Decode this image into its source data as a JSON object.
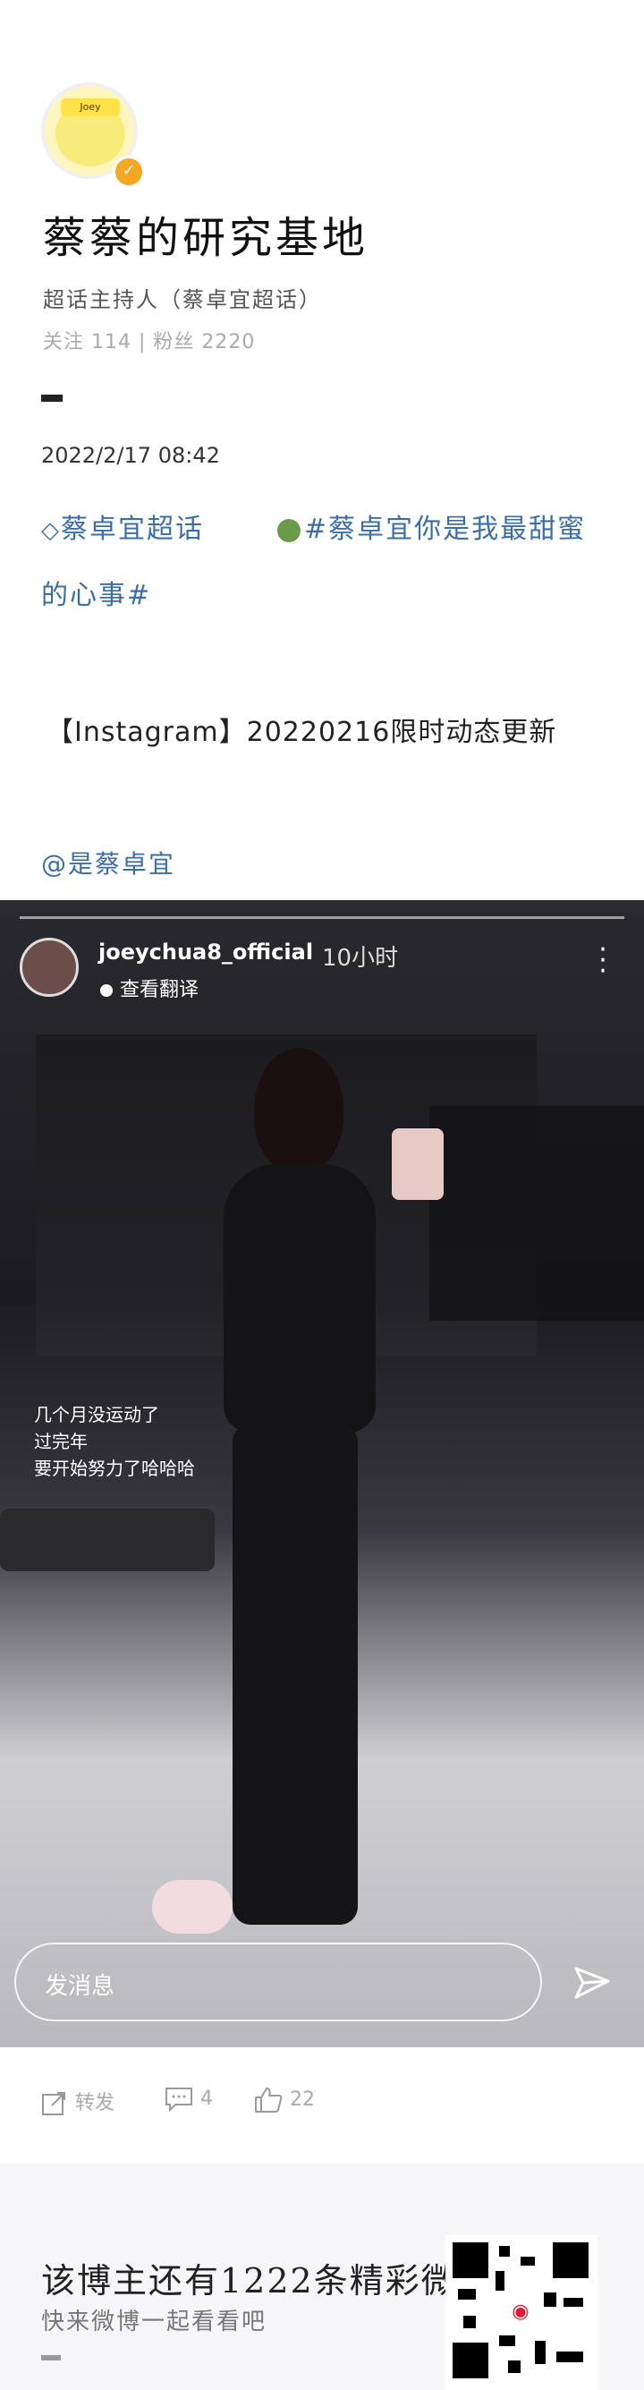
{
  "profile": {
    "name": "蔡蔡的研究基地",
    "role": "超话主持人（蔡卓宜超话）",
    "stats": "关注 114 | 粉丝 2220",
    "avatar_tag": "Joey"
  },
  "post": {
    "date": "2022/2/17 08:42",
    "super_topic": "蔡卓宜超话",
    "hashtag": "#蔡卓宜你是我最甜蜜",
    "hashtag_cont": "的心事#",
    "text": "【Instagram】20220216限时动态更新",
    "mention": "@是蔡卓宜"
  },
  "story": {
    "username": "joeychua8_official",
    "time": "10小时",
    "translate": "查看翻译",
    "caption": [
      "几个月没运动了",
      "过完年",
      "要开始努力了哈哈哈"
    ],
    "message_placeholder": "发消息"
  },
  "actions": {
    "repost": "转发",
    "comments": "4",
    "likes": "22"
  },
  "footer": {
    "headline": "该博主还有1222条精彩微博",
    "subline": "快来微博一起看看吧"
  },
  "colors": {
    "link": "#3b6ea8",
    "badge": "#f5a623",
    "footer_bg": "#f6f6f8"
  }
}
